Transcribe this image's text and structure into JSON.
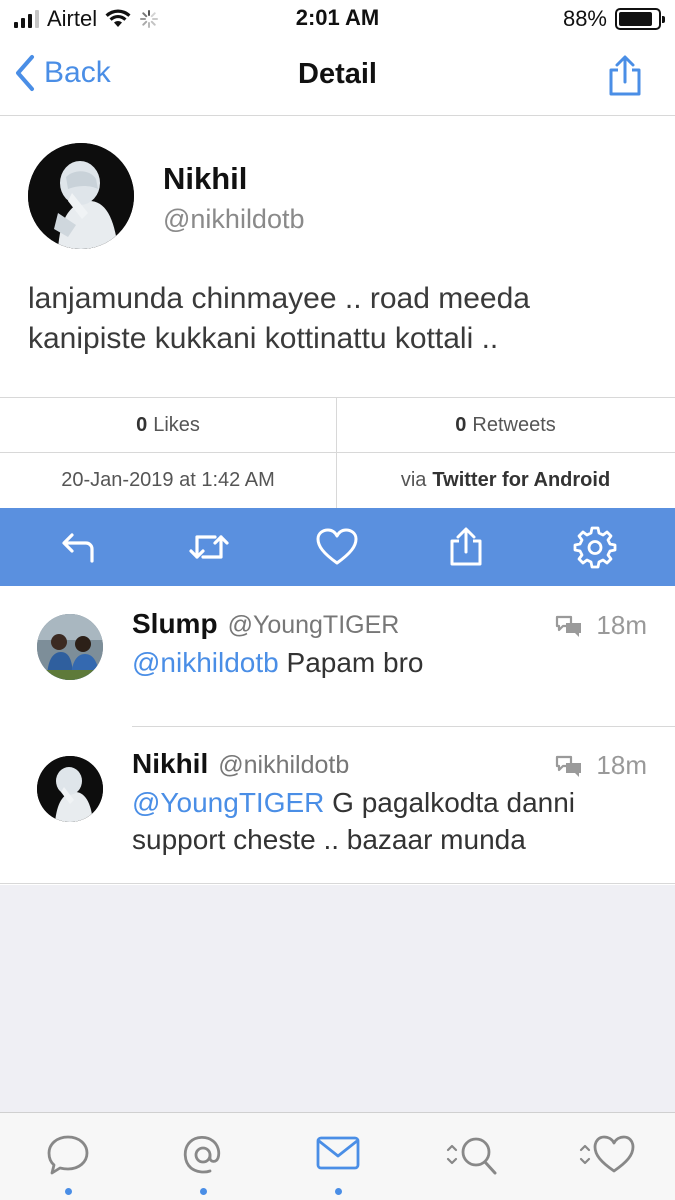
{
  "status_bar": {
    "carrier": "Airtel",
    "time": "2:01 AM",
    "battery_percent": "88%",
    "battery_level": 0.88,
    "signal_bars_filled": 3,
    "signal_bars_total": 4
  },
  "nav": {
    "back_label": "Back",
    "title": "Detail"
  },
  "tweet": {
    "author_name": "Nikhil",
    "author_handle": "@nikhildotb",
    "text": "lanjamunda chinmayee .. road meeda kanipiste kukkani kottinattu kottali .."
  },
  "stats": {
    "likes_count": "0",
    "likes_label": "Likes",
    "retweets_count": "0",
    "retweets_label": "Retweets",
    "date": "20-Jan-2019 at 1:42 AM",
    "via_prefix": "via",
    "via_client": "Twitter for Android"
  },
  "colors": {
    "accent": "#4a8ee6",
    "action_bar": "#5a90df",
    "background_empty": "#efeff4"
  },
  "actions": [
    "reply-icon",
    "retweet-icon",
    "heart-icon",
    "share-icon",
    "gear-icon"
  ],
  "replies": [
    {
      "name": "Slump",
      "handle": "@YoungTIGER",
      "time": "18m",
      "mention": "@nikhildotb",
      "text": " Papam bro"
    },
    {
      "name": "Nikhil",
      "handle": "@nikhildotb",
      "time": "18m",
      "mention": "@YoungTIGER",
      "text": " G pagalkodta danni support cheste .. bazaar munda"
    }
  ],
  "tabs": [
    "speech-bubble-icon",
    "mention-icon",
    "mail-icon",
    "search-icon",
    "heart-icon"
  ]
}
